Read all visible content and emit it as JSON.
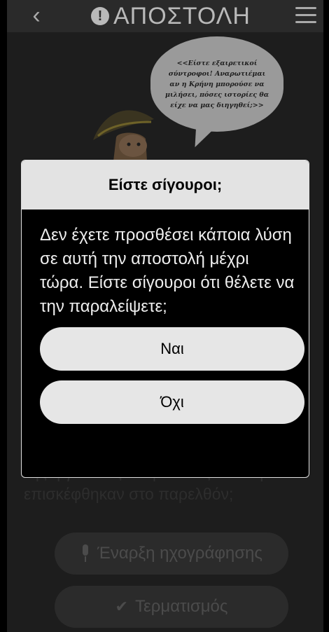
{
  "header": {
    "title": "ΑΠΟΣΤΟΛΗ",
    "back_icon": "chevron-left-icon",
    "alert_icon": "exclamation-circle-icon",
    "menu_icon": "hamburger-menu-icon"
  },
  "speech_bubble": {
    "text": "<<Είστε εξαιρετικοί σύντροφοι! Αναρωτιέμαι αν η Κρήνη μπορούσε να μιλήσει, πόσες ιστορίες θα είχε να μας διηγηθεί;>>"
  },
  "background": {
    "question_line1": "της ή για τους ανθρώπους που την",
    "question_line2": "επισκέφθηκαν στο παρελθόν;"
  },
  "actions": {
    "record_label": "Έναρξη ηχογράφησης",
    "finish_label": "Τερματισμός"
  },
  "modal": {
    "title": "Είστε σίγουροι;",
    "message": "Δεν έχετε προσθέσει κάποια λύση σε αυτή την αποστολή μέχρι τώρα. Είστε σίγουροι ότι θέλετε να την παραλείψετε;",
    "yes_label": "Ναι",
    "no_label": "Όχι"
  },
  "colors": {
    "overlay_bg": "#1d1d1d",
    "modal_header_bg": "#e3e3e3",
    "modal_button_bg": "#e6e6e6"
  }
}
